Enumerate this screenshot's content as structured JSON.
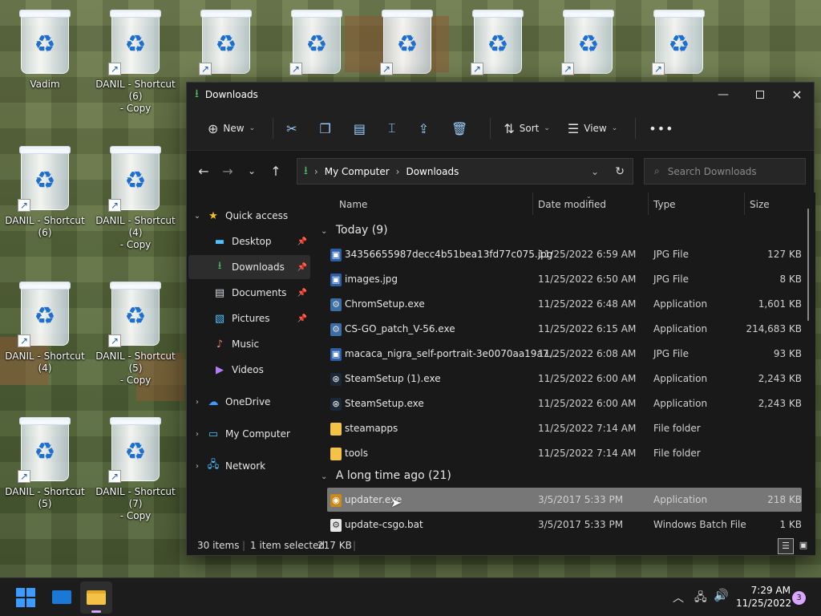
{
  "desktop": {
    "icons": [
      {
        "label": "Vadim",
        "shortcut": false
      },
      {
        "label": "DANIL - Shortcut (6)\n- Copy",
        "shortcut": true
      },
      {
        "label": "DANIL - Shortcut (6)",
        "shortcut": true
      },
      {
        "label": "DANIL - Shortcut (4)\n- Copy",
        "shortcut": true
      },
      {
        "label": "DANIL - Shortcut (4)",
        "shortcut": true
      },
      {
        "label": "DANIL - Shortcut (5)\n- Copy",
        "shortcut": true
      },
      {
        "label": "DANIL - Shortcut (5)",
        "shortcut": true
      },
      {
        "label": "DANIL - Shortcut (7)\n- Copy",
        "shortcut": true
      }
    ],
    "top_row_count": 6
  },
  "window": {
    "title": "Downloads",
    "toolbar": {
      "new_label": "New",
      "sort_label": "Sort",
      "view_label": "View"
    },
    "address": {
      "crumb1": "My Computer",
      "crumb2": "Downloads"
    },
    "search": {
      "placeholder": "Search Downloads"
    },
    "sidebar": {
      "quick_access": "Quick access",
      "items": [
        {
          "label": "Desktop",
          "pinned": true
        },
        {
          "label": "Downloads",
          "pinned": true
        },
        {
          "label": "Documents",
          "pinned": true
        },
        {
          "label": "Pictures",
          "pinned": true
        },
        {
          "label": "Music",
          "pinned": false
        },
        {
          "label": "Videos",
          "pinned": false
        }
      ],
      "onedrive": "OneDrive",
      "my_computer": "My Computer",
      "network": "Network"
    },
    "columns": {
      "name": "Name",
      "date": "Date modified",
      "type": "Type",
      "size": "Size"
    },
    "groups": [
      {
        "label": "Today (9)"
      },
      {
        "label": "A long time ago (21)"
      }
    ],
    "files_today": [
      {
        "name": "34356655987decc4b51bea13fd77c075.jpg",
        "date": "11/25/2022 6:59 AM",
        "type": "JPG File",
        "size": "127 KB",
        "icon": "image-file-icon"
      },
      {
        "name": "images.jpg",
        "date": "11/25/2022 6:50 AM",
        "type": "JPG File",
        "size": "8 KB",
        "icon": "image-file-icon"
      },
      {
        "name": "ChromSetup.exe",
        "date": "11/25/2022 6:48 AM",
        "type": "Application",
        "size": "1,601 KB",
        "icon": "installer-icon"
      },
      {
        "name": "CS-GO_patch_V-56.exe",
        "date": "11/25/2022 6:15 AM",
        "type": "Application",
        "size": "214,683 KB",
        "icon": "installer-icon"
      },
      {
        "name": "macaca_nigra_self-portrait-3e0070aa19a7...",
        "date": "11/25/2022 6:08 AM",
        "type": "JPG File",
        "size": "93 KB",
        "icon": "image-file-icon"
      },
      {
        "name": "SteamSetup (1).exe",
        "date": "11/25/2022 6:00 AM",
        "type": "Application",
        "size": "2,243 KB",
        "icon": "steam-icon"
      },
      {
        "name": "SteamSetup.exe",
        "date": "11/25/2022 6:00 AM",
        "type": "Application",
        "size": "2,243 KB",
        "icon": "steam-icon"
      },
      {
        "name": "steamapps",
        "date": "11/25/2022 7:14 AM",
        "type": "File folder",
        "size": "",
        "icon": "folder-icon"
      },
      {
        "name": "tools",
        "date": "11/25/2022 7:14 AM",
        "type": "File folder",
        "size": "",
        "icon": "folder-icon"
      }
    ],
    "files_old": [
      {
        "name": "updater.exe",
        "date": "3/5/2017 5:33 PM",
        "type": "Application",
        "size": "218 KB",
        "icon": "updater-icon"
      },
      {
        "name": "update-csgo.bat",
        "date": "3/5/2017 5:33 PM",
        "type": "Windows Batch File",
        "size": "1 KB",
        "icon": "batch-file-icon"
      }
    ],
    "status": {
      "items": "30 items",
      "selected": "1 item selected",
      "size": "217 KB"
    }
  },
  "taskbar": {
    "time": "7:29 AM",
    "date": "11/25/2022",
    "notifications": "3"
  },
  "colors": {
    "accent": "#4cc2ff",
    "folder": "#f3c246",
    "selected_row": "#777777"
  }
}
